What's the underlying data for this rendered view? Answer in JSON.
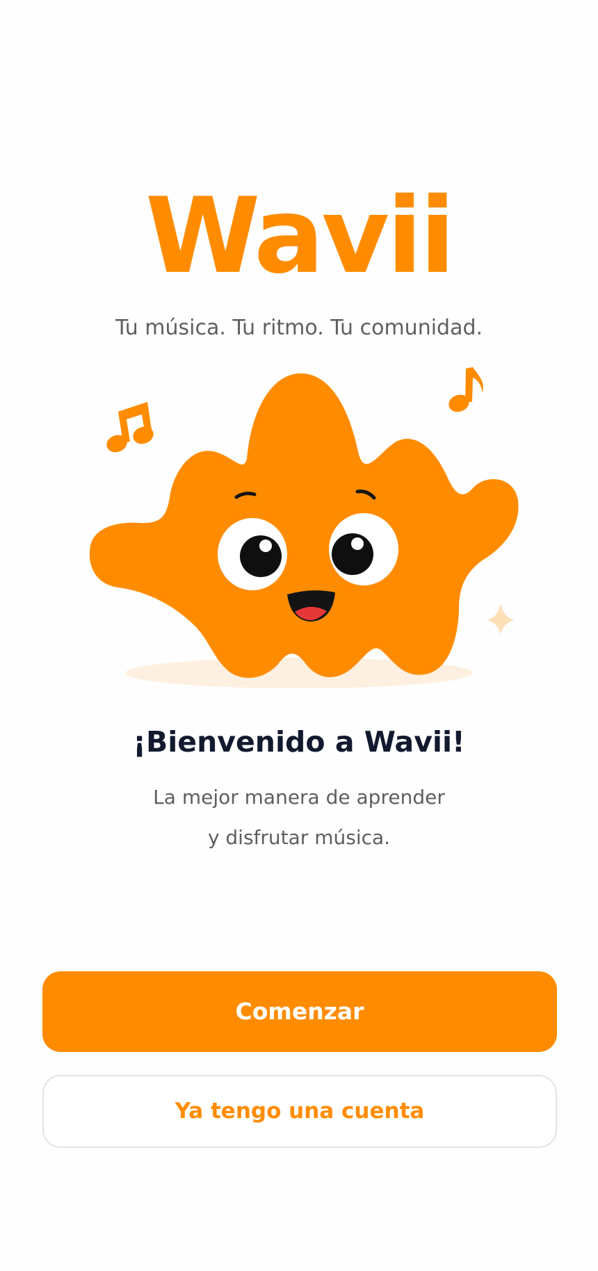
{
  "app": {
    "logo_text": "Wavii",
    "tagline": "Tu música. Tu ritmo. Tu comunidad.",
    "brand_color": "#ff8c00"
  },
  "illustration": {
    "mascot": "orange-blob-mascot",
    "decorations": [
      "music-note-icon",
      "music-note-icon",
      "sparkle-icon"
    ]
  },
  "welcome": {
    "title": "¡Bienvenido a Wavii!",
    "line1": "La mejor manera de aprender",
    "line2": "y disfrutar música."
  },
  "actions": {
    "primary_label": "Comenzar",
    "secondary_label": "Ya tengo una cuenta"
  },
  "colors": {
    "accent": "#ff8c00",
    "title": "#131a2f",
    "text_muted": "#5e5e5e",
    "button_border": "#e3e3e3"
  }
}
